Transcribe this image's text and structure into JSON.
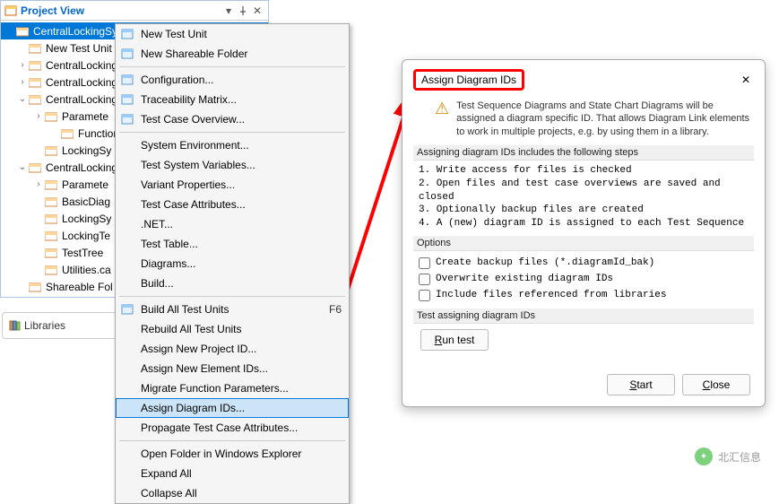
{
  "panel": {
    "title": "Project View",
    "pin_icon": "pin-icon",
    "close_icon": "close-icon",
    "dropdown_icon": "dropdown-icon"
  },
  "tree": {
    "items": [
      {
        "indent": 0,
        "twisty": "",
        "label": "CentralLockingSystem",
        "selected": true
      },
      {
        "indent": 1,
        "twisty": "",
        "label": "New Test Unit"
      },
      {
        "indent": 1,
        "twisty": "›",
        "label": "CentralLocking"
      },
      {
        "indent": 1,
        "twisty": "›",
        "label": "CentralLocking"
      },
      {
        "indent": 1,
        "twisty": "⌄",
        "label": "CentralLocking"
      },
      {
        "indent": 2,
        "twisty": "›",
        "label": "Paramete"
      },
      {
        "indent": 3,
        "twisty": "",
        "label": "FunctionL"
      },
      {
        "indent": 2,
        "twisty": "",
        "label": "LockingSy"
      },
      {
        "indent": 1,
        "twisty": "⌄",
        "label": "CentralLocking"
      },
      {
        "indent": 2,
        "twisty": "›",
        "label": "Paramete"
      },
      {
        "indent": 2,
        "twisty": "",
        "label": "BasicDiag"
      },
      {
        "indent": 2,
        "twisty": "",
        "label": "LockingSy"
      },
      {
        "indent": 2,
        "twisty": "",
        "label": "LockingTe"
      },
      {
        "indent": 2,
        "twisty": "",
        "label": "TestTree"
      },
      {
        "indent": 2,
        "twisty": "",
        "label": "Utilities.ca"
      },
      {
        "indent": 1,
        "twisty": "",
        "label": "Shareable Fol"
      }
    ]
  },
  "libraries": {
    "label": "Libraries"
  },
  "menu": {
    "items": [
      {
        "label": "New Test Unit",
        "icon": true
      },
      {
        "label": "New Shareable Folder",
        "icon": true
      },
      {
        "sep": true
      },
      {
        "label": "Configuration...",
        "icon": true
      },
      {
        "label": "Traceability Matrix...",
        "icon": true
      },
      {
        "label": "Test Case Overview...",
        "icon": true
      },
      {
        "sep": true
      },
      {
        "label": "System Environment..."
      },
      {
        "label": "Test System Variables..."
      },
      {
        "label": "Variant Properties..."
      },
      {
        "label": "Test Case Attributes..."
      },
      {
        "label": ".NET..."
      },
      {
        "label": "Test Table..."
      },
      {
        "label": "Diagrams..."
      },
      {
        "label": "Build..."
      },
      {
        "sep": true
      },
      {
        "label": "Build All Test Units",
        "icon": true,
        "shortcut": "F6"
      },
      {
        "label": "Rebuild All Test Units"
      },
      {
        "label": "Assign New Project ID..."
      },
      {
        "label": "Assign New Element IDs..."
      },
      {
        "label": "Migrate Function Parameters..."
      },
      {
        "label": "Assign Diagram IDs...",
        "highlight": true
      },
      {
        "label": "Propagate Test Case Attributes..."
      },
      {
        "sep": true
      },
      {
        "label": "Open Folder in Windows Explorer"
      },
      {
        "label": "Expand All"
      },
      {
        "label": "Collapse All"
      }
    ]
  },
  "dialog": {
    "title": "Assign Diagram IDs",
    "info": "Test Sequence Diagrams and State Chart Diagrams will be assigned a diagram specific ID. That allows Diagram Link elements to work in multiple projects, e.g. by using them in a library.",
    "steps_header": "Assigning diagram IDs includes the following steps",
    "steps_text": "1. Write access for files is checked\n2. Open files and test case overviews are saved and closed\n3. Optionally backup files are created\n4. A (new) diagram ID is assigned to each Test Sequence",
    "options_header": "Options",
    "opt1": "Create backup files (*.diagramId_bak)",
    "opt2": "Overwrite existing diagram IDs",
    "opt3": "Include files referenced from libraries",
    "test_header": "Test assigning diagram IDs",
    "run_test": "Run test",
    "start": "Start",
    "close": "Close"
  },
  "watermark": {
    "text": "北汇信息"
  }
}
